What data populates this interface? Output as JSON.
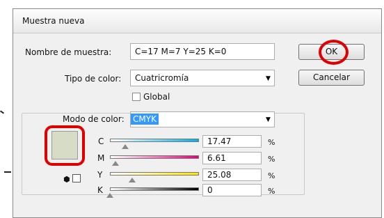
{
  "colors": {
    "swatch": "#d7dcc6",
    "highlight": "#3399ff",
    "annotation": "#e00000"
  },
  "dialog": {
    "title": "Muestra nueva",
    "name_label": "Nombre de muestra:",
    "name_value": "C=17 M=7 Y=25 K=0",
    "type_label": "Tipo de color:",
    "type_value": "Cuatricromía",
    "global_label": "Global",
    "global_checked": false,
    "mode_label": "Modo de color:",
    "mode_value": "CMYK",
    "ok_label": "OK",
    "cancel_label": "Cancelar"
  },
  "sliders": [
    {
      "label": "C",
      "value": "17.47",
      "percent": 17.47,
      "unit": "%"
    },
    {
      "label": "M",
      "value": "6.61",
      "percent": 6.61,
      "unit": "%"
    },
    {
      "label": "Y",
      "value": "25.08",
      "percent": 25.08,
      "unit": "%"
    },
    {
      "label": "K",
      "value": "0",
      "percent": 0,
      "unit": "%"
    }
  ],
  "icons": [
    "gamut-cube-icon",
    "web-safe-square-icon",
    "dropdown-arrow-icon"
  ]
}
